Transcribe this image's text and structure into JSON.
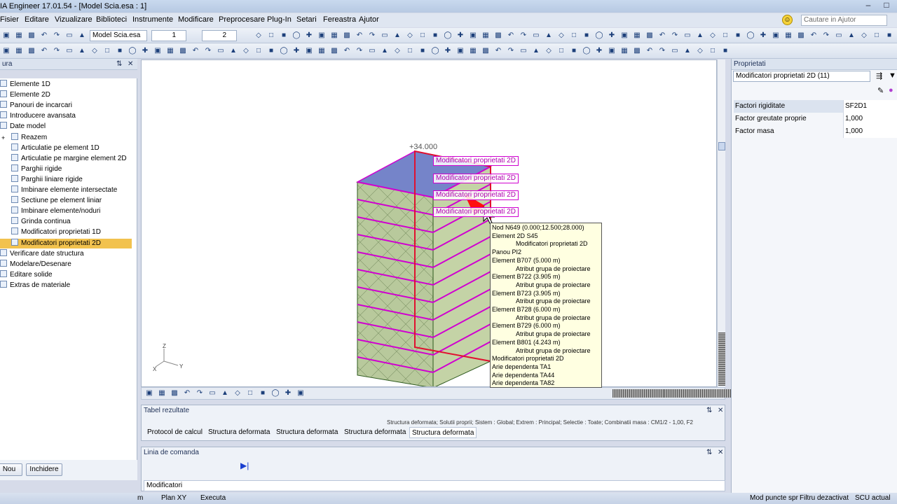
{
  "title": "IA Engineer 17.01.54 - [Model Scia.esa : 1]",
  "menu": [
    "Fisier",
    "Editare",
    "Vizualizare",
    "Biblioteci",
    "Instrumente",
    "Modificare",
    "Preprocesare",
    "Plug-In",
    "Setari",
    "Fereastra",
    "Ajutor"
  ],
  "help_placeholder": "Cautare in Ajutor",
  "toolbar": {
    "file_combo": "Model Scia.esa",
    "spin1": "1",
    "spin2": "2"
  },
  "tree_header": "ura",
  "tree_items": [
    {
      "label": "Elemente 1D",
      "level": 0,
      "expander": ""
    },
    {
      "label": "Elemente 2D",
      "level": 0,
      "expander": ""
    },
    {
      "label": "Panouri de incarcari",
      "level": 0,
      "expander": ""
    },
    {
      "label": "Introducere avansata",
      "level": 0,
      "expander": ""
    },
    {
      "label": "Date model",
      "level": 0,
      "expander": ""
    },
    {
      "label": "Reazem",
      "level": 1,
      "expander": "+"
    },
    {
      "label": "Articulatie pe element 1D",
      "level": 1,
      "expander": ""
    },
    {
      "label": "Articulatie pe margine element 2D",
      "level": 1,
      "expander": ""
    },
    {
      "label": "Parghii rigide",
      "level": 1,
      "expander": ""
    },
    {
      "label": "Parghii liniare rigide",
      "level": 1,
      "expander": ""
    },
    {
      "label": "Imbinare elemente intersectate",
      "level": 1,
      "expander": ""
    },
    {
      "label": "Sectiune pe element liniar",
      "level": 1,
      "expander": ""
    },
    {
      "label": "Imbinare elemente/noduri",
      "level": 1,
      "expander": ""
    },
    {
      "label": "Grinda continua",
      "level": 1,
      "expander": ""
    },
    {
      "label": "Modificatori proprietati 1D",
      "level": 1,
      "expander": ""
    },
    {
      "label": "Modificatori proprietati 2D",
      "level": 1,
      "expander": "",
      "selected": true
    },
    {
      "label": "Verificare date structura",
      "level": 0,
      "expander": ""
    },
    {
      "label": "Modelare/Desenare",
      "level": 0,
      "expander": ""
    },
    {
      "label": "Editare solide",
      "level": 0,
      "expander": ""
    },
    {
      "label": "Extras de materiale",
      "level": 0,
      "expander": ""
    }
  ],
  "tree_buttons": {
    "new": "Nou",
    "close": "Inchidere"
  },
  "viewport": {
    "elevation": "+34.000",
    "labels": [
      "Modificatori proprietati 2D",
      "Modificatori proprietati 2D",
      "Modificatori proprietati 2D",
      "Modificatori proprietati 2D"
    ],
    "axis_z": "Z",
    "axis_x": "X",
    "axis_y": "Y"
  },
  "tooltip": [
    {
      "text": "Nod N649 (0.000;12.500;28.000)",
      "indent": false
    },
    {
      "text": "Element 2D S45",
      "indent": false
    },
    {
      "text": "Modificatori proprietati 2D",
      "indent": true
    },
    {
      "text": "Panou PI2",
      "indent": false
    },
    {
      "text": "Element B707 (5.000 m)",
      "indent": false
    },
    {
      "text": "Atribut grupa de proiectare",
      "indent": true
    },
    {
      "text": "Element B722 (3.905 m)",
      "indent": false
    },
    {
      "text": "Atribut grupa de proiectare",
      "indent": true
    },
    {
      "text": "Element B723 (3.905 m)",
      "indent": false
    },
    {
      "text": "Atribut grupa de proiectare",
      "indent": true
    },
    {
      "text": "Element B728 (6.000 m)",
      "indent": false
    },
    {
      "text": "Atribut grupa de proiectare",
      "indent": true
    },
    {
      "text": "Element B729 (6.000 m)",
      "indent": false
    },
    {
      "text": "Atribut grupa de proiectare",
      "indent": true
    },
    {
      "text": "Element B801 (4.243 m)",
      "indent": false
    },
    {
      "text": "Atribut grupa de proiectare",
      "indent": true
    },
    {
      "text": "Modificatori proprietati 2D",
      "indent": false
    },
    {
      "text": "Arie dependenta TA1",
      "indent": false
    },
    {
      "text": "Arie dependenta TA44",
      "indent": false
    },
    {
      "text": "Arie dependenta TA82",
      "indent": false
    }
  ],
  "properties": {
    "header": "Proprietati",
    "selector": "Modificatori proprietati 2D (11)",
    "rows": [
      {
        "key": "Factori rigiditate",
        "value": "SF2D1"
      },
      {
        "key": "Factor greutate proprie",
        "value": "1,000"
      },
      {
        "key": "Factor masa",
        "value": "1,000"
      }
    ]
  },
  "results": {
    "header": "Tabel rezultate",
    "summary": "Structura deformata; Solutii proprii; Sistem : Global; Extrem : Principal; Selectie : Toate; Combinatii masa : CM1/2 - 1,00, F2",
    "tabs": [
      "Protocol de calcul",
      "Structura deformata",
      "Structura deformata",
      "Structura deformata",
      "Structura deformata"
    ]
  },
  "command": {
    "header": "Linia de comanda",
    "value": "Modificatori"
  },
  "status": {
    "m": "m",
    "plan": "Plan XY",
    "exec": "Executa",
    "snap": "Mod puncte spr",
    "filter": "Filtru dezactivat",
    "ucs": "SCU actual"
  }
}
